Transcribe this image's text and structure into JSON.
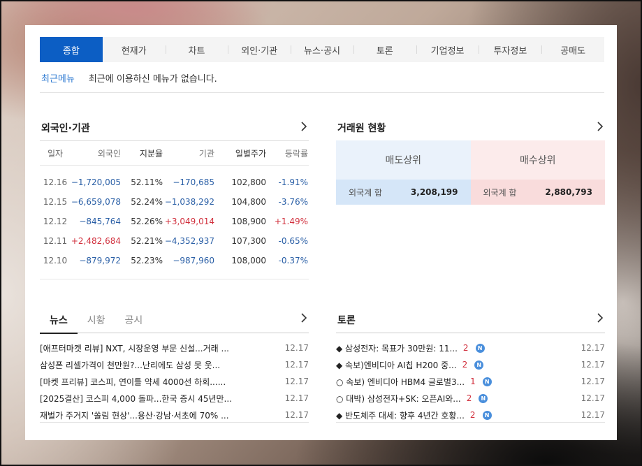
{
  "tabs": [
    "종합",
    "현재가",
    "차트",
    "외인·기관",
    "뉴스·공시",
    "토론",
    "기업정보",
    "투자정보",
    "공매도"
  ],
  "recent": {
    "label": "최근메뉴",
    "message": "최근에 이용하신 메뉴가 없습니다."
  },
  "investor": {
    "title": "외국인·기관",
    "headers": [
      "일자",
      "외국인",
      "지분율",
      "기관",
      "일별주가",
      "등락률"
    ],
    "rows": [
      {
        "date": "12.16",
        "foreign": "−1,720,005",
        "pct": "52.11%",
        "inst": "−170,685",
        "price": "102,800",
        "chg": "-1.91%"
      },
      {
        "date": "12.15",
        "foreign": "−6,659,078",
        "pct": "52.24%",
        "inst": "−1,038,292",
        "price": "104,800",
        "chg": "-3.76%"
      },
      {
        "date": "12.12",
        "foreign": "−845,764",
        "pct": "52.26%",
        "inst": "+3,049,014",
        "price": "108,900",
        "chg": "+1.49%"
      },
      {
        "date": "12.11",
        "foreign": "+2,482,684",
        "pct": "52.21%",
        "inst": "−4,352,937",
        "price": "107,300",
        "chg": "-0.65%"
      },
      {
        "date": "12.10",
        "foreign": "−879,972",
        "pct": "52.23%",
        "inst": "−987,960",
        "price": "108,000",
        "chg": "-0.37%"
      }
    ]
  },
  "broker": {
    "title": "거래원 현황",
    "sell": {
      "label": "매도상위",
      "key": "외국계 합",
      "value": "3,208,199"
    },
    "buy": {
      "label": "매수상위",
      "key": "외국계 합",
      "value": "2,880,793"
    }
  },
  "news": {
    "tabs": [
      "뉴스",
      "시황",
      "공시"
    ],
    "items": [
      {
        "title": "[애프터마켓 리뷰] NXT, 시장운영 부문 신설...거래 ...",
        "date": "12.17"
      },
      {
        "title": "삼성폰 리셀가격이 천만원?...난리에도 삼성 못 웃...",
        "date": "12.17"
      },
      {
        "title": "[마켓 프리뷰] 코스피, 연이틀 약세 4000선 하회......",
        "date": "12.17"
      },
      {
        "title": "[2025결산] 코스피 4,000 돌파...한국 증시 45년만...",
        "date": "12.17"
      },
      {
        "title": "재벌가 주거지 '쏠림 현상'...용산·강남·서초에 70% ...",
        "date": "12.17"
      }
    ]
  },
  "discussion": {
    "title": "토론",
    "items": [
      {
        "title": "◆ 삼성전자: 목표가 30만원: 11...",
        "count": "2",
        "date": "12.17"
      },
      {
        "title": "◆ 속보)엔비디아 AI칩 H200 중...",
        "count": "2",
        "date": "12.17"
      },
      {
        "title": "○ 속보) 엔비디아 HBM4 글로벌3...",
        "count": "1",
        "date": "12.17"
      },
      {
        "title": "○ 대박) 삼성전자+SK: 오픈AI와...",
        "count": "2",
        "date": "12.17"
      },
      {
        "title": "◆ 반도체주 대세: 향후 4년간 호황...",
        "count": "2",
        "date": "12.17"
      }
    ]
  },
  "badge_letter": "N",
  "colors": {
    "accent": "#0c5ec4",
    "up": "#d1303d",
    "down": "#2a5fa6",
    "link": "#2f7bd2"
  }
}
